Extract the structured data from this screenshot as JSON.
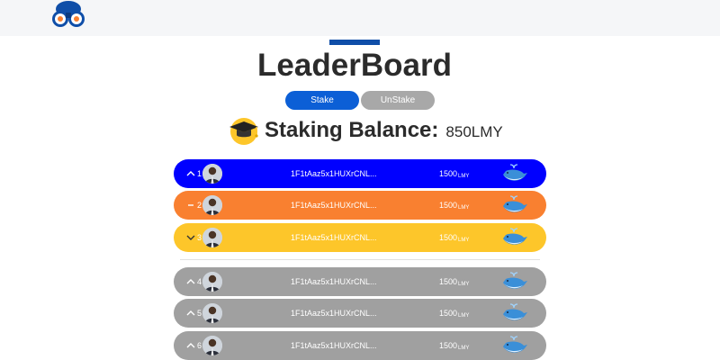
{
  "header": {
    "logo_icon": "binoculars-logo-icon"
  },
  "page": {
    "title": "LeaderBoard"
  },
  "actions": {
    "stake_label": "Stake",
    "unstake_label": "UnStake"
  },
  "balance": {
    "icon": "graduation-cap-icon",
    "label": "Staking Balance:",
    "value": "850LMY"
  },
  "colors": {
    "accent": "#0f4ea8",
    "stake": "#0c5fd6",
    "unstake": "#a8a8a8",
    "rank1": "#0000ff",
    "rank2": "#f98030",
    "rank3": "#fdc62a",
    "other": "#a0a0a0"
  },
  "leaderboard": [
    {
      "rank": "1",
      "trend": "up",
      "address": "1F1tAaz5x1HUXrCNL...",
      "amount": "1500",
      "unit": "LMY",
      "badge": "whale-icon"
    },
    {
      "rank": "2",
      "trend": "same",
      "address": "1F1tAaz5x1HUXrCNL...",
      "amount": "1500",
      "unit": "LMY",
      "badge": "whale-icon"
    },
    {
      "rank": "3",
      "trend": "down",
      "address": "1F1tAaz5x1HUXrCNL...",
      "amount": "1500",
      "unit": "LMY",
      "badge": "whale-icon"
    },
    {
      "rank": "4",
      "trend": "up",
      "address": "1F1tAaz5x1HUXrCNL...",
      "amount": "1500",
      "unit": "LMY",
      "badge": "whale-icon"
    },
    {
      "rank": "5",
      "trend": "up",
      "address": "1F1tAaz5x1HUXrCNL...",
      "amount": "1500",
      "unit": "LMY",
      "badge": "whale-icon"
    },
    {
      "rank": "6",
      "trend": "up",
      "address": "1F1tAaz5x1HUXrCNL...",
      "amount": "1500",
      "unit": "LMY",
      "badge": "whale-icon"
    }
  ]
}
